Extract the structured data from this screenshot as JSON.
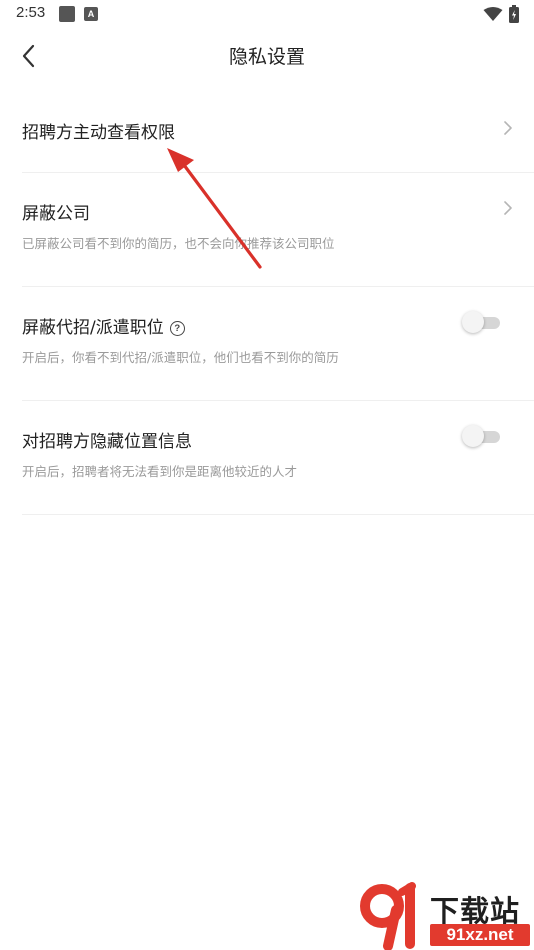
{
  "status_bar": {
    "time": "2:53",
    "badge_letter": "A"
  },
  "header": {
    "title": "隐私设置"
  },
  "settings": [
    {
      "title": "招聘方主动查看权限",
      "desc": "",
      "control": "chevron"
    },
    {
      "title": "屏蔽公司",
      "desc": "已屏蔽公司看不到你的简历，也不会向你推荐该公司职位",
      "control": "chevron"
    },
    {
      "title": "屏蔽代招/派遣职位",
      "desc": "开启后，你看不到代招/派遣职位，他们也看不到你的简历",
      "control": "toggle",
      "enabled": false
    },
    {
      "title": "对招聘方隐藏位置信息",
      "desc": "开启后，招聘者将无法看到你是距离他较近的人才",
      "control": "toggle",
      "enabled": false
    }
  ],
  "watermark": {
    "title": "下载站",
    "site": "91xz.net"
  },
  "colors": {
    "annotation_arrow": "#d9312a",
    "toggle_off_track": "#d6d6d6",
    "desc_text": "#9a9a9a"
  }
}
